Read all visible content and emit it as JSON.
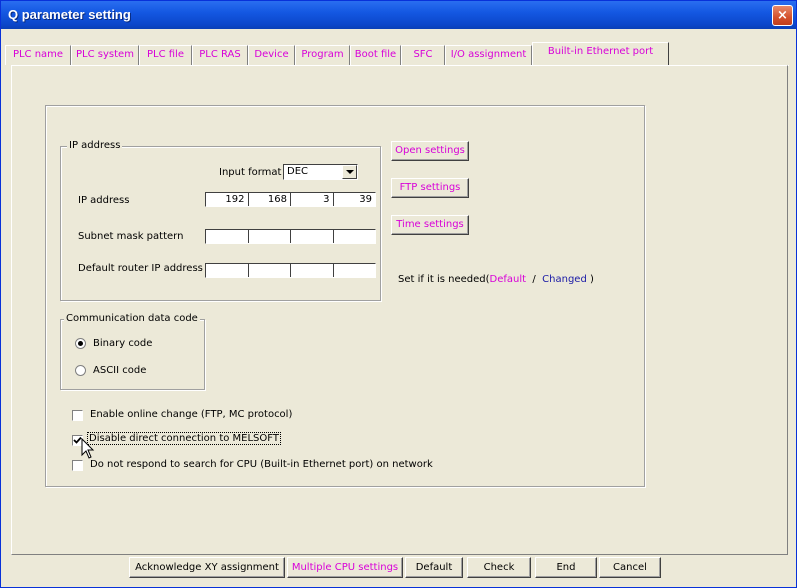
{
  "window": {
    "title": "Q parameter setting",
    "close": "×"
  },
  "tabs": [
    {
      "label": "PLC name"
    },
    {
      "label": "PLC system"
    },
    {
      "label": "PLC file"
    },
    {
      "label": "PLC RAS"
    },
    {
      "label": "Device"
    },
    {
      "label": "Program"
    },
    {
      "label": "Boot file"
    },
    {
      "label": "SFC"
    },
    {
      "label": "I/O assignment"
    },
    {
      "label": "Built-in Ethernet port"
    }
  ],
  "ip_group": {
    "title": "IP address",
    "input_format_label": "Input format",
    "input_format_value": "DEC",
    "ip_label": "IP address",
    "ip_values": [
      "192",
      "168",
      "3",
      "39"
    ],
    "subnet_label": "Subnet mask pattern",
    "subnet_values": [
      "",
      "",
      "",
      ""
    ],
    "router_label": "Default router IP address",
    "router_values": [
      "",
      "",
      "",
      ""
    ]
  },
  "side_buttons": {
    "open": "Open settings",
    "ftp": "FTP settings",
    "time": "Time settings"
  },
  "hint": {
    "prefix": "Set if it is needed(",
    "default": "Default",
    "slash": "/",
    "changed": "Changed",
    "suffix": ")"
  },
  "comm_group": {
    "title": "Communication data code",
    "binary": "Binary code",
    "ascii": "ASCII code",
    "selected": "binary"
  },
  "options": {
    "online_change": "Enable online change (FTP, MC protocol)",
    "disable_direct": "Disable direct connection to MELSOFT",
    "no_respond": "Do not respond to search for CPU (Built-in Ethernet port) on network"
  },
  "bottom_buttons": {
    "ack_xy": "Acknowledge XY assignment",
    "multi_cpu": "Multiple CPU settings",
    "default": "Default",
    "check": "Check",
    "end": "End",
    "cancel": "Cancel"
  },
  "colors": {
    "accent": "#d800d8",
    "hint_blue": "#1a1aa6",
    "title_bar": "#0b46c9"
  }
}
